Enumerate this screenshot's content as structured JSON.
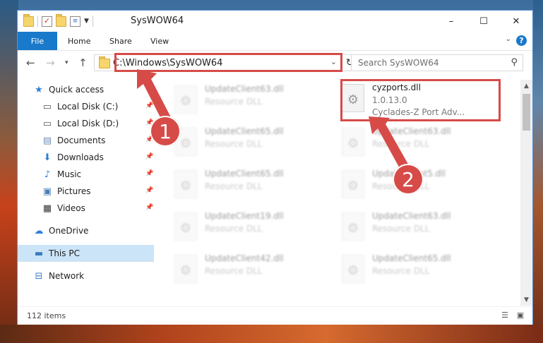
{
  "window": {
    "title": "SysWOW64",
    "controls": {
      "minimize": "–",
      "maximize": "☐",
      "close": "✕"
    }
  },
  "ribbon": {
    "file_tab": "File",
    "tabs": [
      "Home",
      "Share",
      "View"
    ],
    "help": "?"
  },
  "address_bar": {
    "path": "C:\\Windows\\SysWOW64",
    "search_placeholder": "Search SysWOW64"
  },
  "sidebar": {
    "items": [
      {
        "label": "Quick access",
        "icon": "star-icon"
      },
      {
        "label": "Local Disk (C:)",
        "icon": "drive-icon",
        "pinned": true
      },
      {
        "label": "Local Disk (D:)",
        "icon": "drive-icon",
        "pinned": true
      },
      {
        "label": "Documents",
        "icon": "documents-icon",
        "pinned": true
      },
      {
        "label": "Downloads",
        "icon": "download-icon",
        "pinned": true
      },
      {
        "label": "Music",
        "icon": "music-icon",
        "pinned": true
      },
      {
        "label": "Pictures",
        "icon": "pictures-icon",
        "pinned": true
      },
      {
        "label": "Videos",
        "icon": "videos-icon",
        "pinned": true
      },
      {
        "label": "OneDrive",
        "icon": "cloud-icon"
      },
      {
        "label": "This PC",
        "icon": "pc-icon",
        "selected": true
      },
      {
        "label": "Network",
        "icon": "network-icon"
      }
    ]
  },
  "files": [
    {
      "name": "UpdateClient63.dll",
      "desc": "Resource DLL"
    },
    {
      "name": "cyzports.dll",
      "version": "1.0.13.0",
      "desc": "Cyclades-Z Port Adv...",
      "highlighted": true
    },
    {
      "name": "UpdateClient65.dll",
      "desc": "Resource DLL"
    },
    {
      "name": "UpdateClient63.dll",
      "desc": "Resource DLL"
    },
    {
      "name": "UpdateClient65.dll",
      "desc": "Resource DLL"
    },
    {
      "name": "UpdateClient5.dll",
      "desc": "Resource DLL"
    },
    {
      "name": "UpdateClient19.dll",
      "desc": "Resource DLL"
    },
    {
      "name": "UpdateClient63.dll",
      "desc": "Resource DLL"
    },
    {
      "name": "UpdateClient42.dll",
      "desc": "Resource DLL"
    },
    {
      "name": "UpdateClient65.dll",
      "desc": "Resource DLL"
    }
  ],
  "status": {
    "items_count": "112 items"
  },
  "callouts": [
    "1",
    "2"
  ],
  "colors": {
    "accent": "#1979ca",
    "highlight": "#d64b48",
    "selection": "#cce4f7"
  }
}
